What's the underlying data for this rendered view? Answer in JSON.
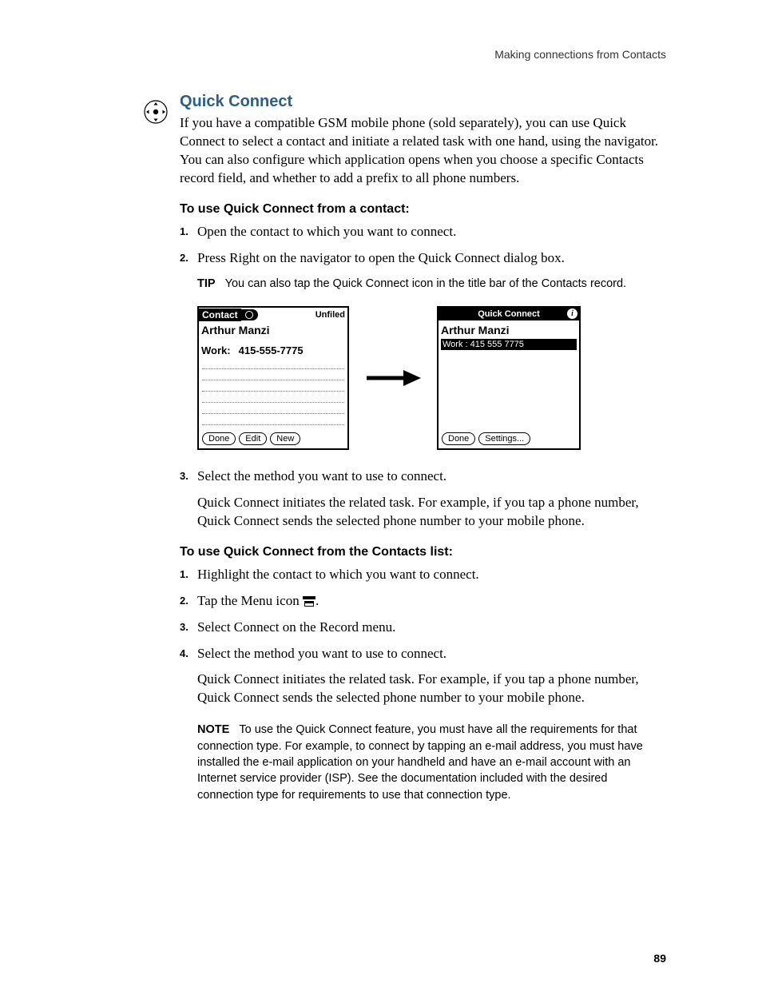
{
  "header": "Making connections from Contacts",
  "section_title": "Quick Connect",
  "intro": "If you have a compatible GSM mobile phone (sold separately), you can use Quick Connect to select a contact and initiate a related task with one hand, using the navigator. You can also configure which application opens when you choose a specific Contacts record field, and whether to add a prefix to all phone numbers.",
  "proc1_title": "To use Quick Connect from a contact:",
  "proc1_steps": {
    "s1": "Open the contact to which you want to connect.",
    "s2": "Press Right on the navigator to open the Quick Connect dialog box."
  },
  "tip_label": "TIP",
  "tip_text": "You can also tap the Quick Connect icon in the title bar of the Contacts record.",
  "fig1": {
    "title": "Contact",
    "category": "Unfiled",
    "name": "Arthur Manzi",
    "field_label": "Work:",
    "field_value": "415-555-7775",
    "btn_done": "Done",
    "btn_edit": "Edit",
    "btn_new": "New"
  },
  "fig2": {
    "title": "Quick Connect",
    "name": "Arthur Manzi",
    "selected": "Work : 415 555 7775",
    "btn_done": "Done",
    "btn_settings": "Settings..."
  },
  "proc1_steps2": {
    "s3": "Select the method you want to use to connect.",
    "s3_body": "Quick Connect initiates the related task. For example, if you tap a phone number, Quick Connect sends the selected phone number to your mobile phone."
  },
  "proc2_title": "To use Quick Connect from the Contacts list:",
  "proc2_steps": {
    "s1": "Highlight the contact to which you want to connect.",
    "s2a": "Tap the Menu icon ",
    "s2b": ".",
    "s3": "Select Connect on the Record menu.",
    "s4": "Select the method you want to use to connect.",
    "s4_body": "Quick Connect initiates the related task. For example, if you tap a phone number, Quick Connect sends the selected phone number to your mobile phone."
  },
  "note_label": "NOTE",
  "note_text": "To use the Quick Connect feature, you must have all the requirements for that connection type. For example, to connect by tapping an e-mail address, you must have installed the e-mail application on your handheld and have an e-mail account with an Internet service provider (ISP). See the documentation included with the desired connection type for requirements to use that connection type.",
  "page_number": "89"
}
